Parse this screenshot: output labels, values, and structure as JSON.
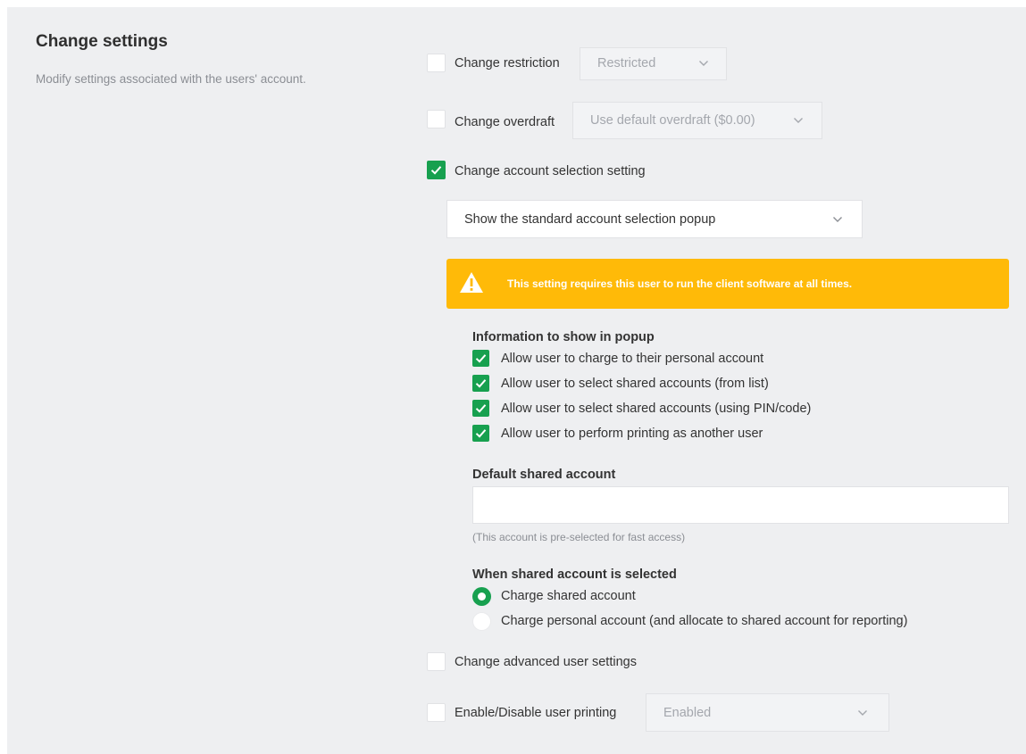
{
  "header": {
    "title": "Change settings",
    "description": "Modify settings associated with the users' account."
  },
  "restriction": {
    "label": "Change restriction",
    "checked": false,
    "select_value": "Restricted"
  },
  "overdraft": {
    "label": "Change overdraft",
    "checked": false,
    "select_value": "Use default overdraft ($0.00)"
  },
  "account_selection": {
    "label": "Change account selection setting",
    "checked": true,
    "select_value": "Show the standard account selection popup",
    "warning": "This setting requires this user to run the client software at all times.",
    "popup_info": {
      "heading": "Information to show in popup",
      "options": [
        "Allow user to charge to their personal account",
        "Allow user to select shared accounts (from list)",
        "Allow user to select shared accounts (using PIN/code)",
        "Allow user to perform printing as another user"
      ]
    },
    "default_shared": {
      "heading": "Default shared account",
      "value": "",
      "hint": "(This account is pre-selected for fast access)"
    },
    "when_selected": {
      "heading": "When shared account is selected",
      "options": [
        "Charge shared account",
        "Charge personal account (and allocate to shared account for reporting)"
      ],
      "selected_index": 0
    }
  },
  "advanced": {
    "label": "Change advanced user settings",
    "checked": false
  },
  "printing": {
    "label": "Enable/Disable user printing",
    "checked": false,
    "select_value": "Enabled"
  },
  "colors": {
    "accent_green": "#17a04f",
    "warning_yellow": "#ffba08",
    "panel_bg": "#eeeff1"
  },
  "icons": {
    "check": "check-icon",
    "chevron": "chevron-down-icon",
    "warning": "warning-icon"
  }
}
